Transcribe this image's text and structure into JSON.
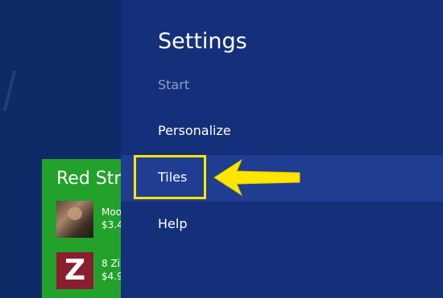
{
  "start_tile": {
    "title": "Red Stri",
    "apps": [
      {
        "name": "Moo",
        "price": "$3.4"
      },
      {
        "name": "8 Zi",
        "price": "$4.9"
      }
    ]
  },
  "settings": {
    "title": "Settings",
    "subtitle": "Start",
    "items": [
      {
        "label": "Personalize"
      },
      {
        "label": "Tiles"
      },
      {
        "label": "Help"
      }
    ]
  },
  "annotation": {
    "color": "#ffe600",
    "icon": "arrow-left-icon"
  },
  "colors": {
    "panel": "#15307a",
    "selected": "#1f3d91",
    "tile": "#23a22b",
    "background": "#0f2a66"
  }
}
